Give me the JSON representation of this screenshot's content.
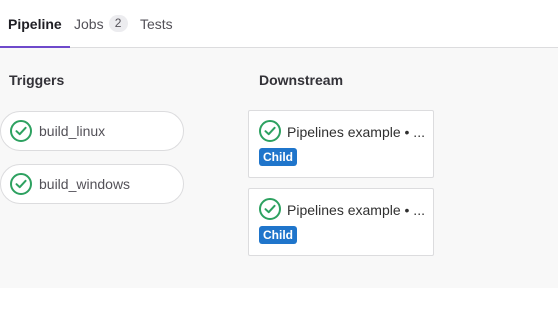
{
  "tabs": [
    {
      "label": "Pipeline",
      "active": true
    },
    {
      "label": "Jobs",
      "count": "2",
      "active": false
    },
    {
      "label": "Tests",
      "active": false
    }
  ],
  "colors": {
    "accent": "#6e49cb",
    "success": "#2da160",
    "child_badge": "#1f75cb"
  },
  "triggers": {
    "title": "Triggers",
    "items": [
      {
        "name": "build_linux",
        "status_icon": "status-success-icon"
      },
      {
        "name": "build_windows",
        "status_icon": "status-success-icon"
      }
    ]
  },
  "downstream": {
    "title": "Downstream",
    "items": [
      {
        "title": "Pipelines example • ...",
        "badge": "Child",
        "status_icon": "status-success-icon"
      },
      {
        "title": "Pipelines example • ...",
        "badge": "Child",
        "status_icon": "status-success-icon"
      }
    ]
  }
}
